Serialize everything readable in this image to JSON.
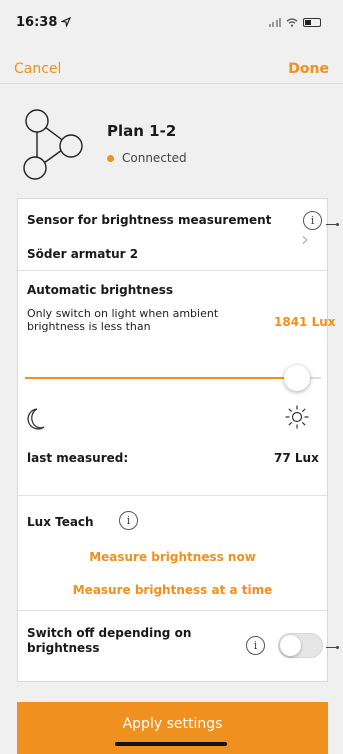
{
  "status_bar": {
    "time": "16:38"
  },
  "nav": {
    "cancel": "Cancel",
    "done": "Done"
  },
  "plan": {
    "title": "Plan 1-2",
    "status": "Connected"
  },
  "sensor": {
    "title": "Sensor for brightness measurement",
    "value": "Söder armatur 2"
  },
  "auto_brightness": {
    "title": "Automatic brightness",
    "description": "Only switch on light when ambient brightness is less than",
    "lux_value": "1841 Lux",
    "slider_fraction": 0.96,
    "last_measured_label": "last measured:",
    "last_measured_value": "77 Lux"
  },
  "lux_teach": {
    "title": "Lux Teach",
    "measure_now": "Measure brightness now",
    "measure_at_time": "Measure brightness at a time"
  },
  "switch_off": {
    "label": "Switch off depending on brightness",
    "enabled": false
  },
  "apply_label": "Apply settings",
  "info_glyph": "i",
  "colors": {
    "accent": "#f0901e",
    "status_dot": "#f0901e",
    "background": "#f0f0f0"
  },
  "icons": [
    "location-arrow-icon",
    "signal-icon",
    "wifi-icon",
    "battery-icon",
    "network-icon",
    "info-icon",
    "chevron-right-icon",
    "moon-icon",
    "sun-icon"
  ]
}
